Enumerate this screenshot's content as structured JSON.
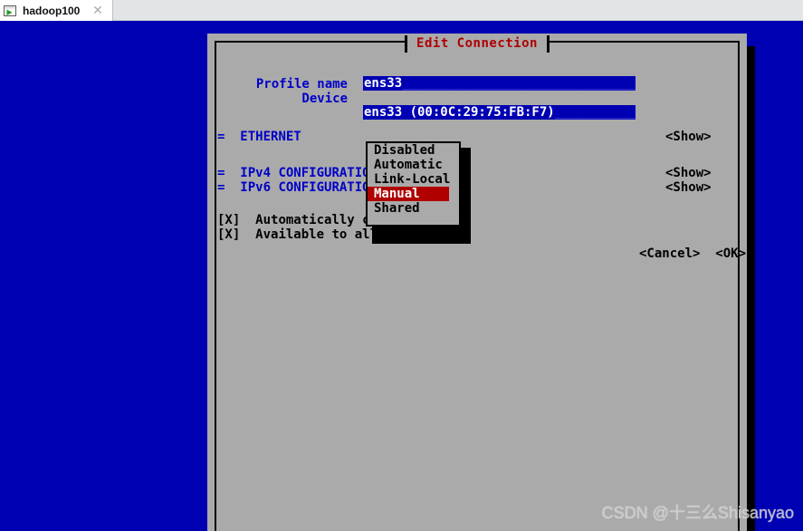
{
  "window": {
    "tab_title": "hadoop100",
    "tab_icon": "terminal-play-icon",
    "close_icon": "✕"
  },
  "dialog": {
    "title": "Edit Connection",
    "fields": [
      {
        "label": "Profile name",
        "value": "ens33"
      },
      {
        "label": "Device",
        "value": "ens33 (00:0C:29:75:FB:F7)"
      }
    ],
    "sections": [
      {
        "marker": "=",
        "label": "ETHERNET",
        "action": "<Show>"
      },
      {
        "marker": "=",
        "label": "IPv4 CONFIGURATION",
        "action": "<Show>"
      },
      {
        "marker": "=",
        "label": "IPv6 CONFIGURATION",
        "action": "<Show>"
      }
    ],
    "checkboxes": [
      {
        "state": "[X]",
        "label": "Automatically co"
      },
      {
        "state": "[X]",
        "label": "Available to all"
      }
    ],
    "buttons": {
      "cancel": "<Cancel>",
      "ok": "<OK>"
    }
  },
  "dropdown": {
    "items": [
      {
        "label": "Disabled",
        "selected": false
      },
      {
        "label": "Automatic",
        "selected": false
      },
      {
        "label": "Link-Local",
        "selected": false
      },
      {
        "label": "Manual",
        "selected": true
      },
      {
        "label": "Shared",
        "selected": false
      }
    ]
  },
  "watermark": {
    "text": "CSDN @十三么Shisanyao"
  },
  "colors": {
    "terminal_bg": "#0000b3",
    "dialog_bg": "#aaaaaa",
    "title_fg": "#b00000",
    "label_fg": "#0000c8",
    "field_bg": "#0000b3",
    "selection_bg": "#b00000"
  }
}
